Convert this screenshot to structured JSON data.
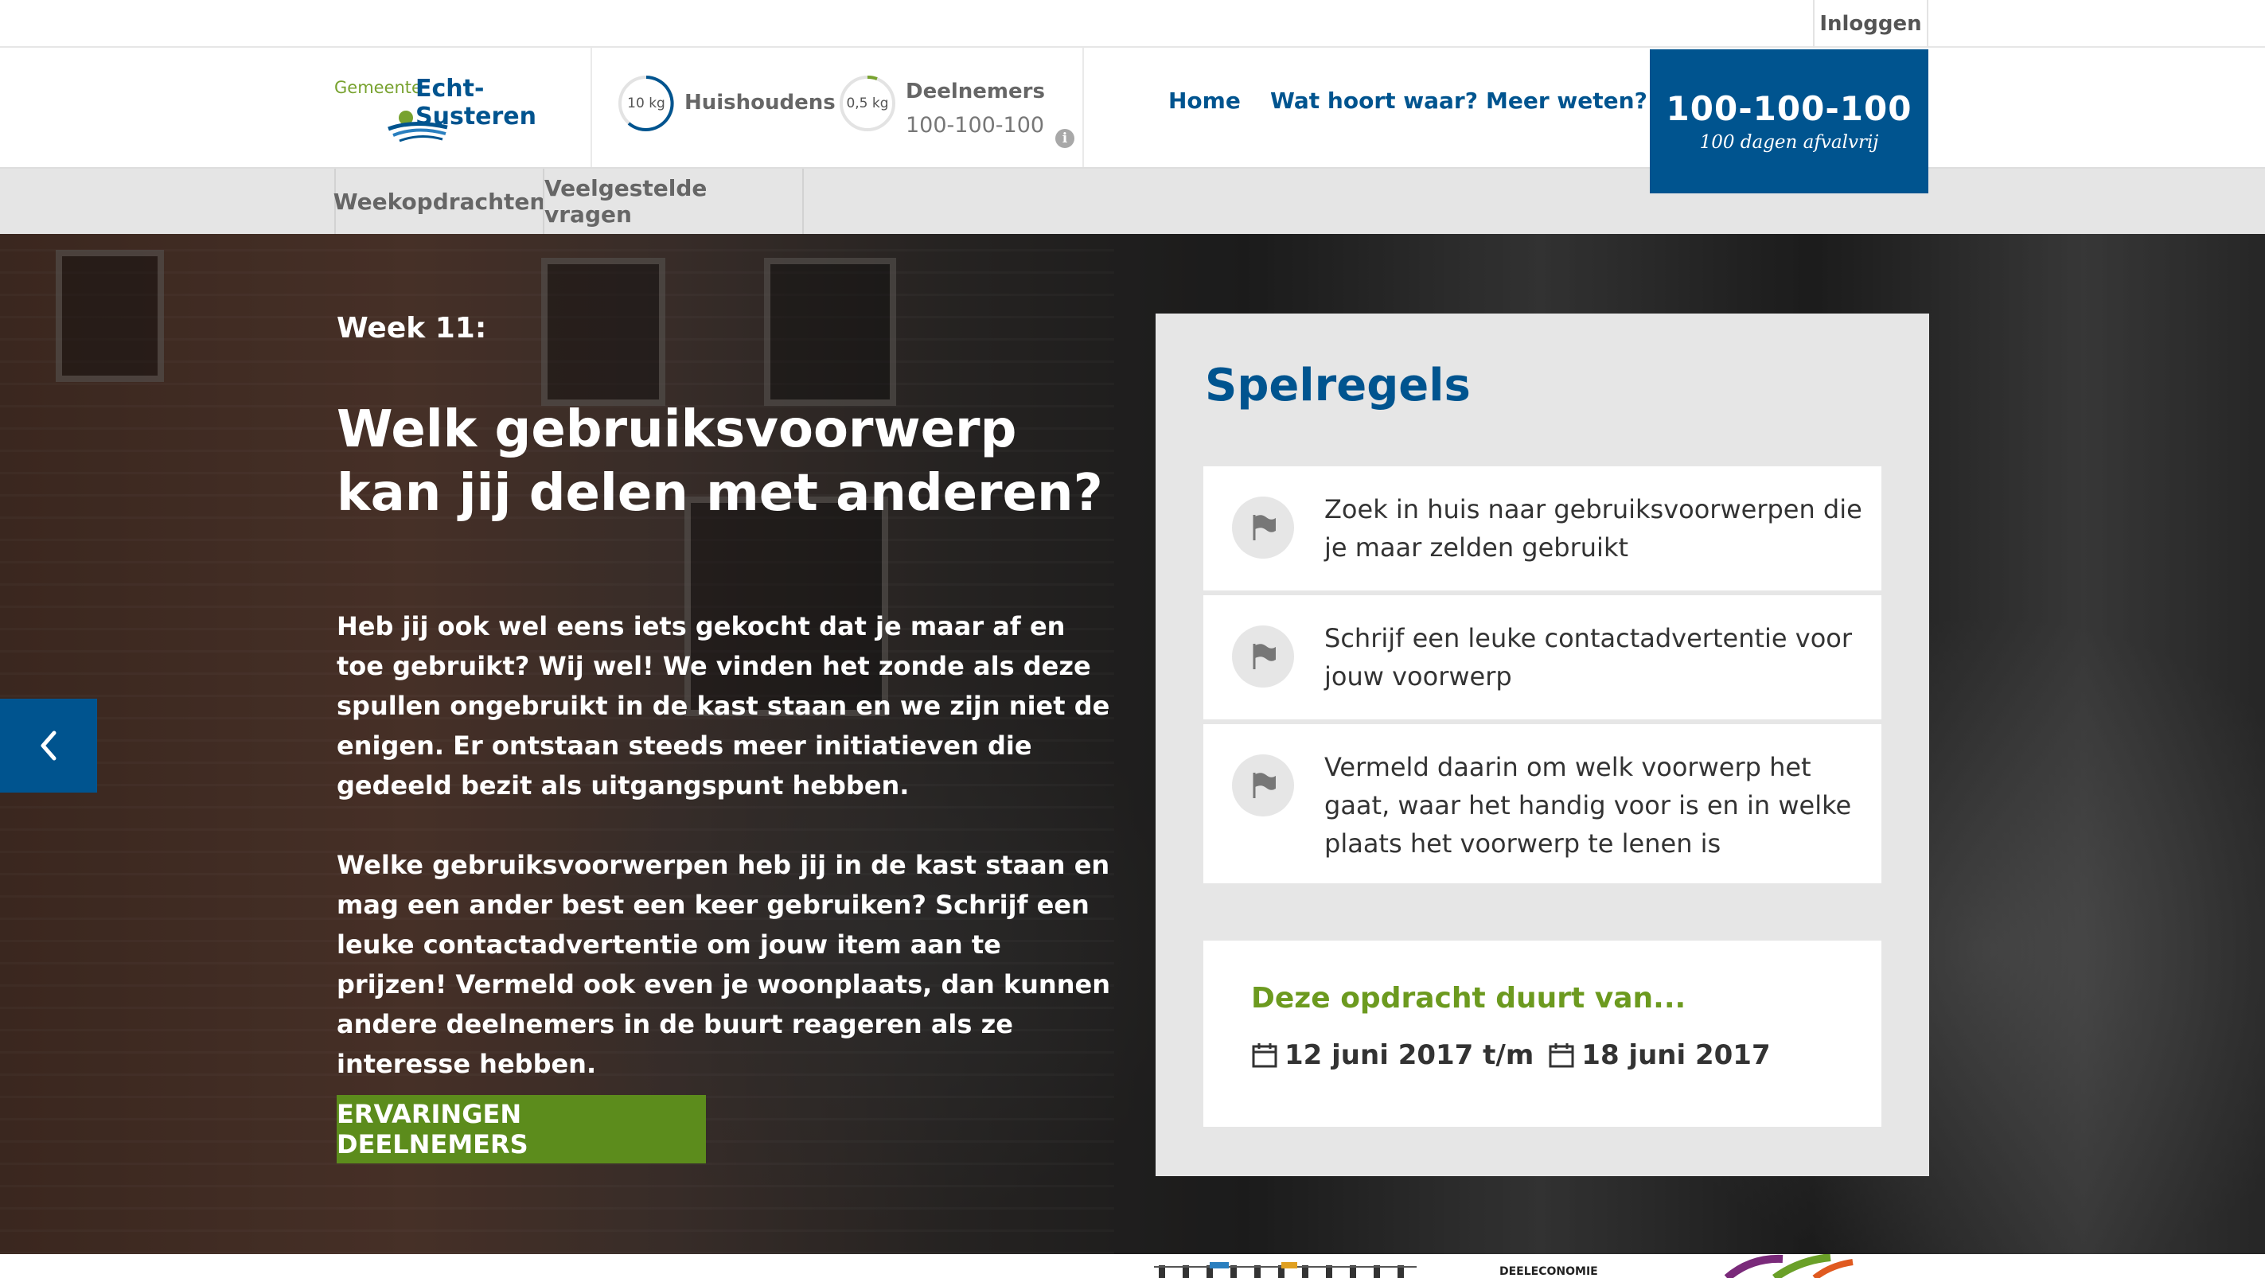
{
  "topbar": {
    "login_label": "Inloggen"
  },
  "header": {
    "logo_small": "Gemeente",
    "logo_main": "Echt-Susteren",
    "stats": [
      {
        "ring_value": "10 kg",
        "label": "Huishoudens",
        "sub": ""
      },
      {
        "ring_value": "0,5 kg",
        "label": "Deelnemers",
        "sub": "100-100-100"
      }
    ],
    "nav": [
      "Home",
      "Wat hoort waar?",
      "Meer weten?"
    ],
    "brand_title": "100-100-100",
    "brand_sub": "100 dagen afvalvrij"
  },
  "subnav": [
    "Weekopdrachten",
    "Veelgestelde vragen"
  ],
  "hero": {
    "week": "Week 11:",
    "title": "Welk gebruiksvoorwerp kan jij delen met anderen?",
    "paragraph1": "Heb jij ook wel eens iets gekocht dat je maar af en toe gebruikt? Wij wel! We vinden het zonde als deze spullen ongebruikt in de kast staan en we zijn niet de enigen. Er ontstaan steeds meer initiatieven die gedeeld bezit als uitgangspunt hebben.",
    "paragraph2": "Welke gebruiksvoorwerpen heb jij in de kast staan en mag een ander best een keer gebruiken? Schrijf een leuke contactadvertentie om jouw item aan te prijzen! Vermeld ook even je woonplaats, dan kunnen andere deelnemers in de buurt reageren als ze interesse hebben.",
    "cta_label": "ERVARINGEN DEELNEMERS"
  },
  "panel": {
    "title": "Spelregels",
    "rules": [
      "Zoek in huis naar gebruiksvoorwerpen die je maar zelden gebruikt",
      "Schrijf een leuke contactadvertentie voor jouw voorwerp",
      "Vermeld daarin om welk voorwerp het gaat, waar het handig voor is en in welke plaats het voorwerp te lenen is"
    ],
    "duration_title": "Deze opdracht duurt van...",
    "date_start": "12 juni 2017 t/m",
    "date_end": "18 juni 2017"
  },
  "footer": {
    "partial_text": "DEELECONOMIE"
  },
  "colors": {
    "brand_blue": "#00548f",
    "green": "#5c8c1c",
    "panel_gray": "#e6e6e6"
  }
}
